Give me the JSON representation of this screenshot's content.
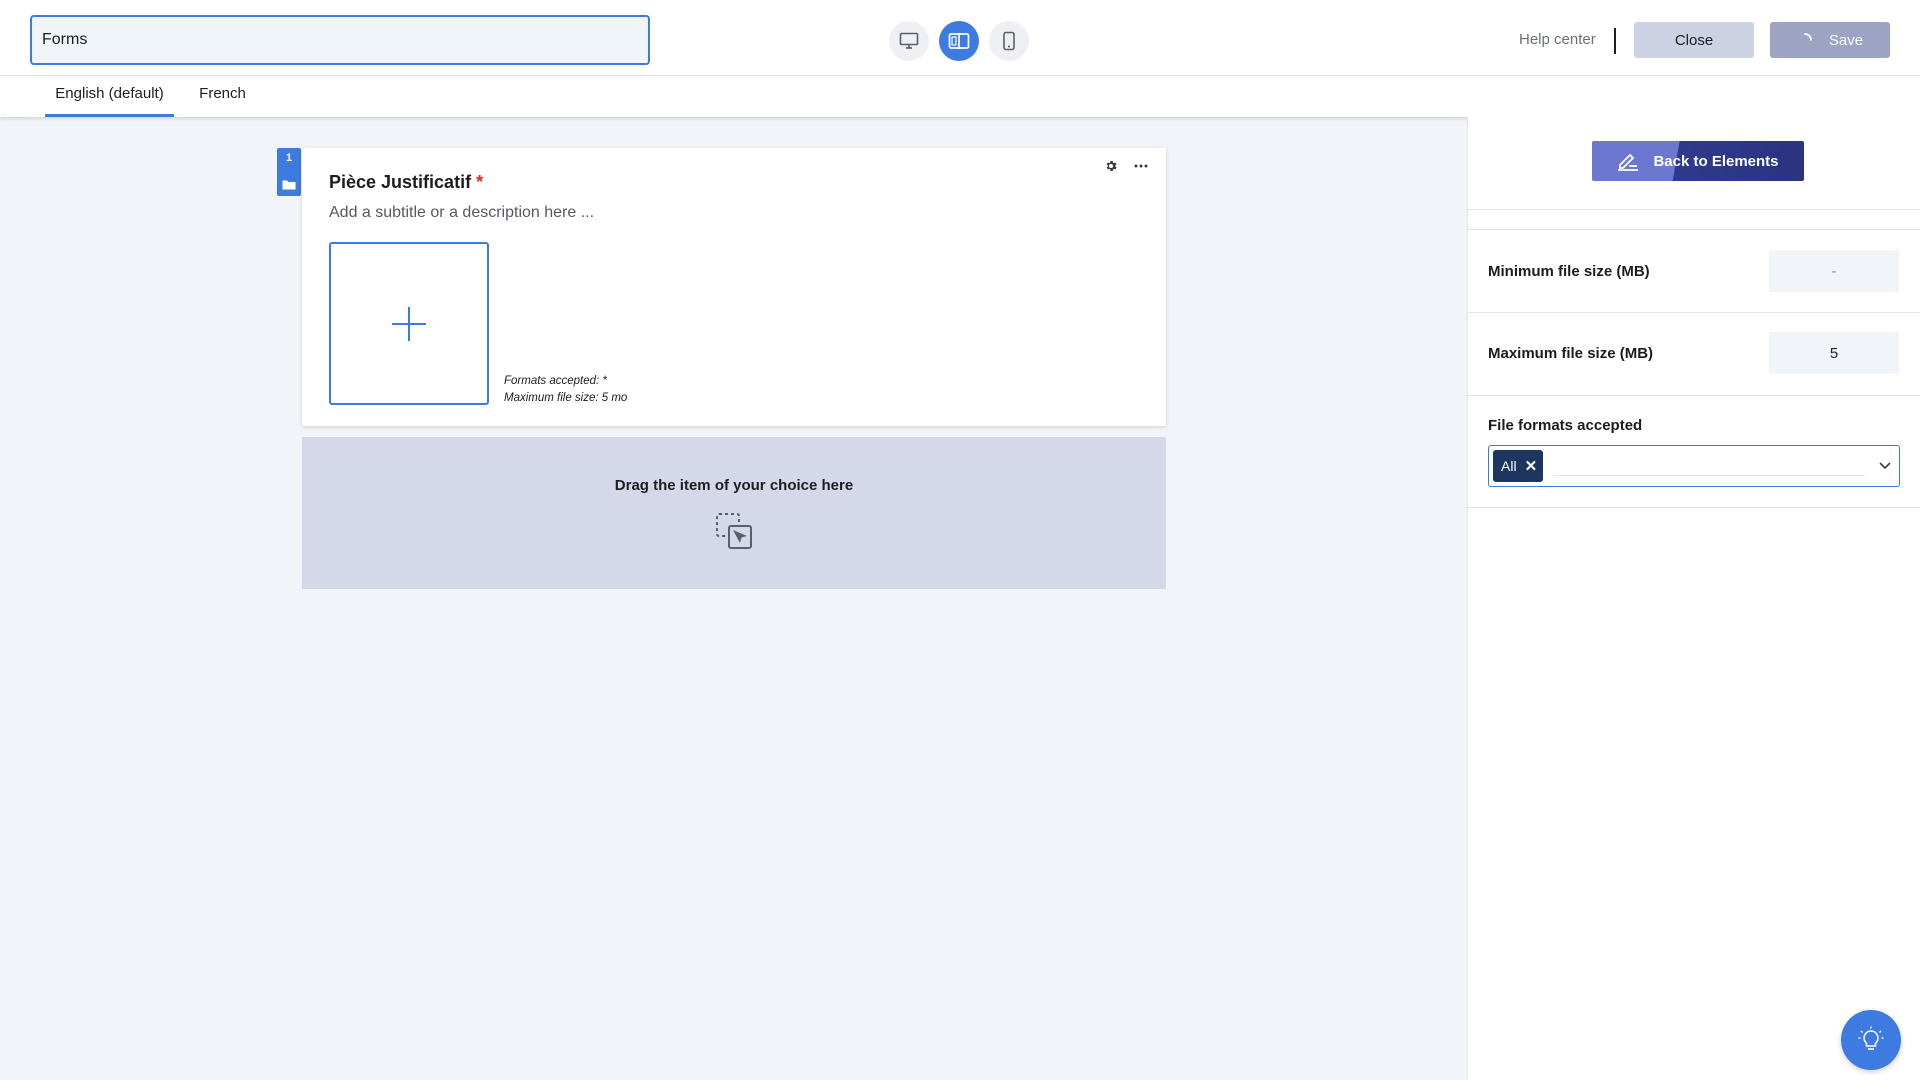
{
  "header": {
    "form_title_value": "Forms",
    "help_center_label": "Help center",
    "close_label": "Close",
    "save_label": "Save",
    "view_modes": [
      "desktop-icon",
      "split-view-icon",
      "mobile-icon"
    ],
    "active_view": "split-view-icon"
  },
  "languages": {
    "tabs": [
      {
        "label": "English (default)",
        "active": true
      },
      {
        "label": "French",
        "active": false
      }
    ]
  },
  "field": {
    "index": "1",
    "title": "Pièce Justificatif",
    "required_mark": "*",
    "subtitle": "Add a subtitle or a description here ...",
    "formats_info": "Formats accepted: *",
    "max_size_info": "Maximum file size: 5 mo"
  },
  "drop_zone": {
    "label": "Drag the item of your choice here"
  },
  "panel": {
    "back_label": "Back to Elements",
    "min_size_label": "Minimum file size (MB)",
    "min_size_placeholder": "-",
    "max_size_label": "Maximum file size (MB)",
    "max_size_value": "5",
    "formats_label": "File formats accepted",
    "formats_chips": [
      "All"
    ]
  },
  "colors": {
    "accent": "#3d7be0",
    "chip_bg": "#1c3660",
    "drop_zone_bg": "#d5d8e8",
    "required": "#e02424"
  }
}
